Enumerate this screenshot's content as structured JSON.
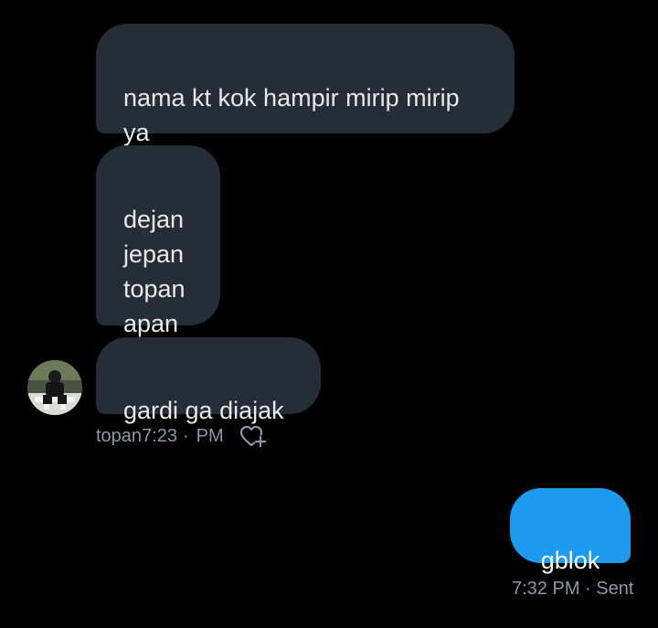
{
  "conversation": {
    "incoming": [
      {
        "text": "nama kt kok hampir mirip mirip\nya"
      },
      {
        "text": "dejan\njepan\ntopan\napan"
      },
      {
        "text": "gardi ga diajak"
      }
    ],
    "incoming_meta": {
      "sender": "topan",
      "time": "7:23",
      "separator": "·",
      "ampm": "PM",
      "react_icon": "heart-plus-icon"
    },
    "outgoing": [
      {
        "text": "gblok"
      }
    ],
    "outgoing_meta": {
      "status": "7:32 PM · Sent"
    }
  },
  "colors": {
    "background": "#000000",
    "incoming_bubble": "#252e37",
    "outgoing_bubble": "#1d9bf0",
    "meta_text": "#8b98a5"
  }
}
